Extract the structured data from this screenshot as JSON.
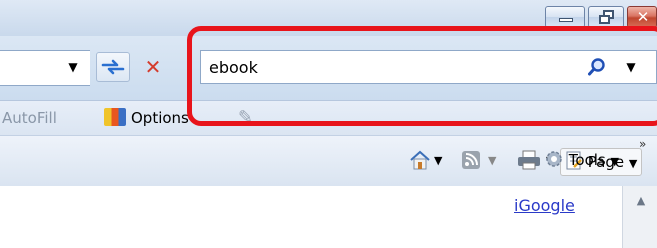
{
  "window": {
    "controls": {
      "minimize": "minimize-icon",
      "restore": "restore-icon",
      "close": "close-icon"
    },
    "close_glyph": "✕"
  },
  "address_bar": {
    "dropdown_glyph": "▼",
    "refresh_icon": "refresh-arrows-icon",
    "stop_glyph": "✕"
  },
  "search": {
    "value": "ebook",
    "go_icon": "magnifier-icon",
    "dropdown_glyph": "▼"
  },
  "links_bar": {
    "autofill_label": "AutoFill",
    "options_label": "Options",
    "pencil_glyph": "✎"
  },
  "command_bar": {
    "home_glyph": "⌂",
    "feeds_glyph": "◙",
    "print_glyph": "⎙",
    "dropdown_glyph": "▼",
    "page_label": "Page",
    "tools_label": "Tools",
    "chevrons": "»"
  },
  "content": {
    "link_label": "iGoogle",
    "scroll_up_glyph": "▲"
  },
  "colors": {
    "highlight": "#e8141b",
    "link": "#2a3ac8",
    "stop": "#d43c2d"
  }
}
